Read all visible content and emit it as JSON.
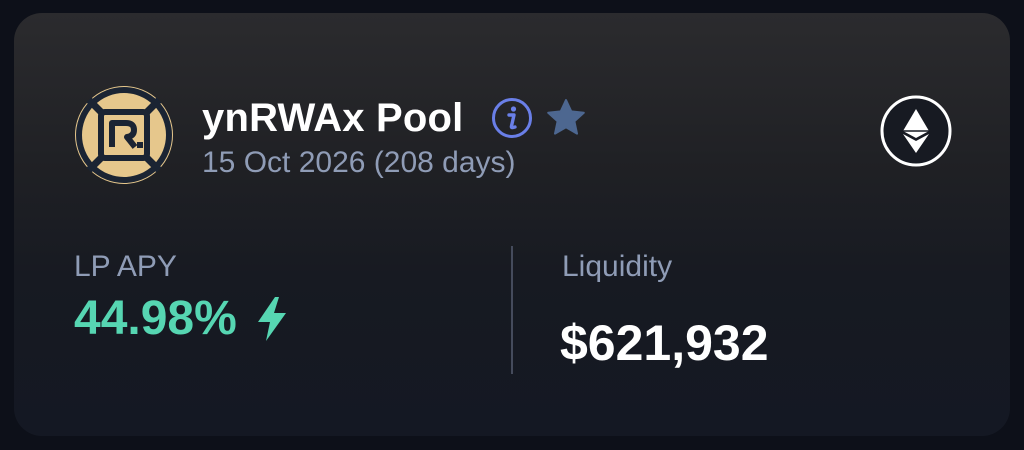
{
  "pool": {
    "name": "ynRWAx Pool",
    "maturity": "15 Oct 2026 (208 days)",
    "logo_icon": "rwa-logo-icon",
    "info_icon": "info-icon",
    "favorite_icon": "star-icon",
    "network_icon": "ethereum-icon"
  },
  "metrics": {
    "lp_apy": {
      "label": "LP APY",
      "value": "44.98%",
      "icon": "lightning-bolt-icon"
    },
    "liquidity": {
      "label": "Liquidity",
      "value": "$621,932"
    }
  },
  "colors": {
    "background": "#0d1019",
    "accent_green": "#56d6b2",
    "info_blue": "#6a7fe8",
    "star_blue": "#4d6790",
    "muted_text": "#8f9cb6",
    "logo_gold": "#e6c78c"
  }
}
